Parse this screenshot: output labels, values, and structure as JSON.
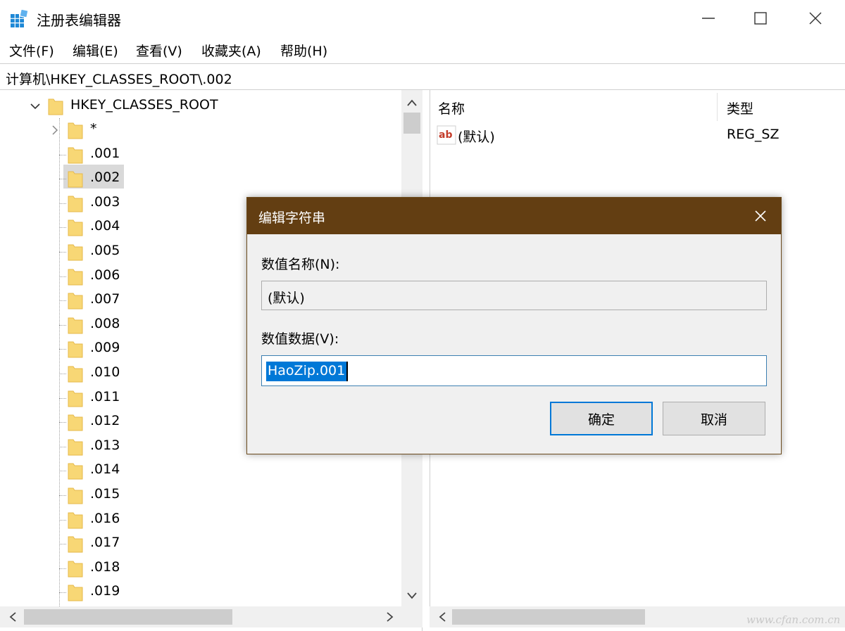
{
  "window": {
    "title": "注册表编辑器",
    "icon": "registry-editor-icon",
    "controls": [
      "minimize-icon",
      "maximize-icon",
      "close-icon"
    ]
  },
  "menu": [
    "文件(F)",
    "编辑(E)",
    "查看(V)",
    "收藏夹(A)",
    "帮助(H)"
  ],
  "address": "计算机\\HKEY_CLASSES_ROOT\\.002",
  "tree": {
    "root": "HKEY_CLASSES_ROOT",
    "items": [
      "*",
      ".001",
      ".002",
      ".003",
      ".004",
      ".005",
      ".006",
      ".007",
      ".008",
      ".009",
      ".010",
      ".011",
      ".012",
      ".013",
      ".014",
      ".015",
      ".016",
      ".017",
      ".018",
      ".019"
    ],
    "selected": ".002"
  },
  "values": {
    "columns": [
      "名称",
      "类型"
    ],
    "rows": [
      {
        "name": "(默认)",
        "type": "REG_SZ",
        "icon": "string-value-icon"
      }
    ]
  },
  "dialog": {
    "title": "编辑字符串",
    "name_label": "数值名称(N):",
    "name_value": "(默认)",
    "data_label": "数值数据(V):",
    "data_value": "HaoZip.001",
    "ok": "确定",
    "cancel": "取消"
  },
  "watermark": "www.cfan.com.cn",
  "colors": {
    "dialog_titlebar": "#633e12",
    "selection": "#0078d7",
    "folder": "#f8d775",
    "tree_selected": "#d9d9d9"
  }
}
